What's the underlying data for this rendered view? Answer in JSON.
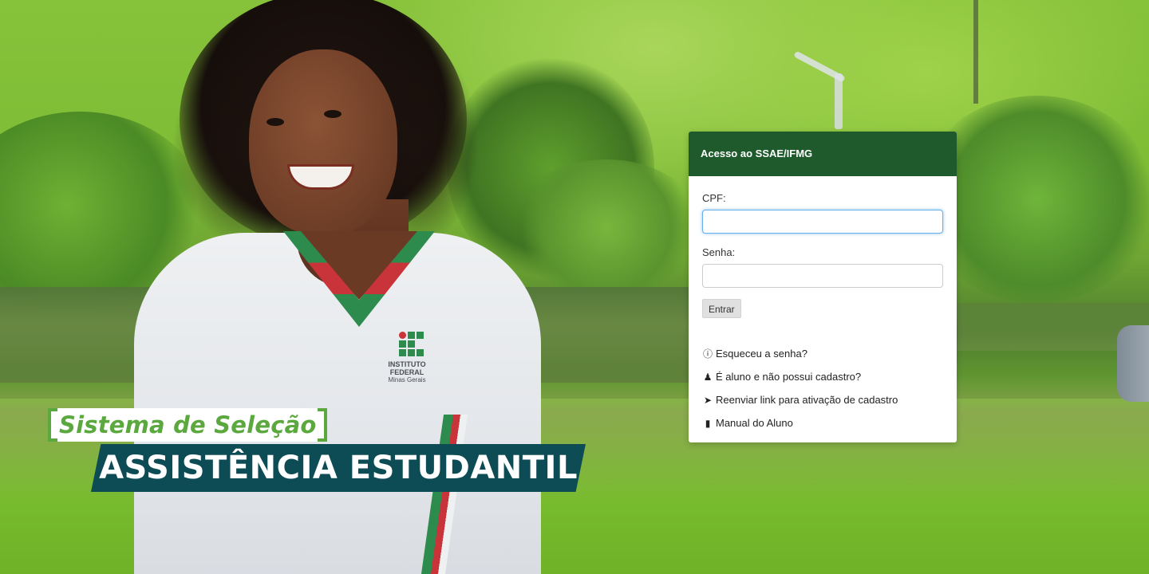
{
  "page": {
    "heading_tag": "Sistema de Seleção",
    "heading_main": "ASSISTÊNCIA ESTUDANTIL"
  },
  "shirt_logo": {
    "line1": "INSTITUTO",
    "line2": "FEDERAL",
    "line3": "Minas Gerais"
  },
  "login": {
    "title": "Acesso ao SSAE/IFMG",
    "cpf_label": "CPF:",
    "cpf_value": "",
    "password_label": "Senha:",
    "password_value": "",
    "submit_label": "Entrar",
    "links": [
      {
        "icon": "question-circle-icon",
        "glyph": "?",
        "label": "Esqueceu a senha?"
      },
      {
        "icon": "user-plus-icon",
        "glyph": "👤+",
        "label": "É aluno e não possui cadastro?"
      },
      {
        "icon": "paper-plane-icon",
        "glyph": "➤",
        "label": "Reenviar link para ativação de cadastro"
      },
      {
        "icon": "book-icon",
        "glyph": "▮",
        "label": "Manual do Aluno"
      }
    ]
  },
  "colors": {
    "header_bg": "#1e5a2b",
    "tag_green": "#5aa83e",
    "banner_teal": "#0d4b55"
  }
}
